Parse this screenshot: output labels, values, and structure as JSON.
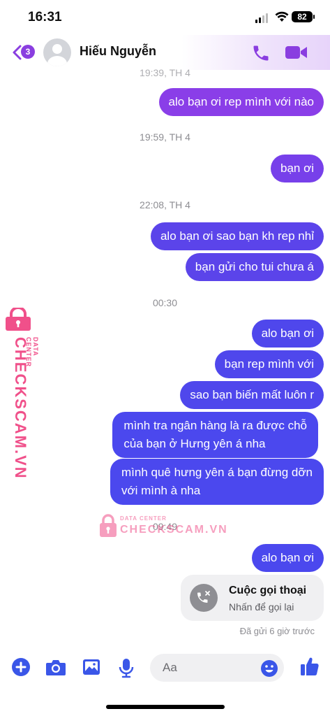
{
  "status_bar": {
    "time": "16:31",
    "battery": "82"
  },
  "header": {
    "unread_count": "3",
    "contact_name": "Hiếu Nguyễn"
  },
  "messages": [
    {
      "id": "ts-partial",
      "type": "time",
      "text": "19:39, TH 4"
    },
    {
      "id": "m1",
      "type": "bubble",
      "text": "alo bạn ơi rep mình với nào"
    },
    {
      "id": "ts1",
      "type": "time",
      "text": "19:59, TH 4"
    },
    {
      "id": "m2",
      "type": "bubble",
      "text": "bạn ơi"
    },
    {
      "id": "ts2",
      "type": "time",
      "text": "22:08, TH 4"
    },
    {
      "id": "m3",
      "type": "bubble",
      "text": "alo bạn ơi sao bạn kh rep nhỉ"
    },
    {
      "id": "m4",
      "type": "bubble",
      "text": "bạn gửi cho tui chưa á"
    },
    {
      "id": "ts3",
      "type": "time",
      "text": "00:30"
    },
    {
      "id": "m5",
      "type": "bubble",
      "text": "alo bạn ơi"
    },
    {
      "id": "m6",
      "type": "bubble",
      "text": "bạn rep mình với"
    },
    {
      "id": "m7",
      "type": "bubble",
      "text": "sao bạn biến mất luôn r"
    },
    {
      "id": "m8",
      "type": "bubble",
      "lines": [
        "mình tra ngân hàng là ra được chỗ",
        "của bạn ở Hưng yên á nha"
      ]
    },
    {
      "id": "m9",
      "type": "bubble",
      "lines": [
        "mình quê hưng yên á bạn đừng dỡn",
        "với mình à nha"
      ]
    },
    {
      "id": "ts4",
      "type": "time",
      "text": "09:49"
    },
    {
      "id": "m10",
      "type": "bubble",
      "text": "alo bạn ơi"
    }
  ],
  "call_card": {
    "title": "Cuộc gọi thoại",
    "subtitle": "Nhấn để gọi lại"
  },
  "sent_status": "Đã gửi 6 giờ trước",
  "composer": {
    "placeholder": "Aa"
  },
  "watermark": {
    "brand": "CHECKSCAM.VN",
    "sub": "DATA CENTER"
  },
  "colors": {
    "accent": "#8a3ee0",
    "bubble_purple": "#8a3ee8",
    "bubble_blue": "#4b48ee",
    "watermark": "#f0508a"
  },
  "icons": [
    "back-chevron-icon",
    "phone-icon",
    "video-camera-icon",
    "plus-icon",
    "camera-icon",
    "gallery-icon",
    "microphone-icon",
    "emoji-icon",
    "thumbs-up-icon",
    "missed-call-icon",
    "lock-icon"
  ]
}
